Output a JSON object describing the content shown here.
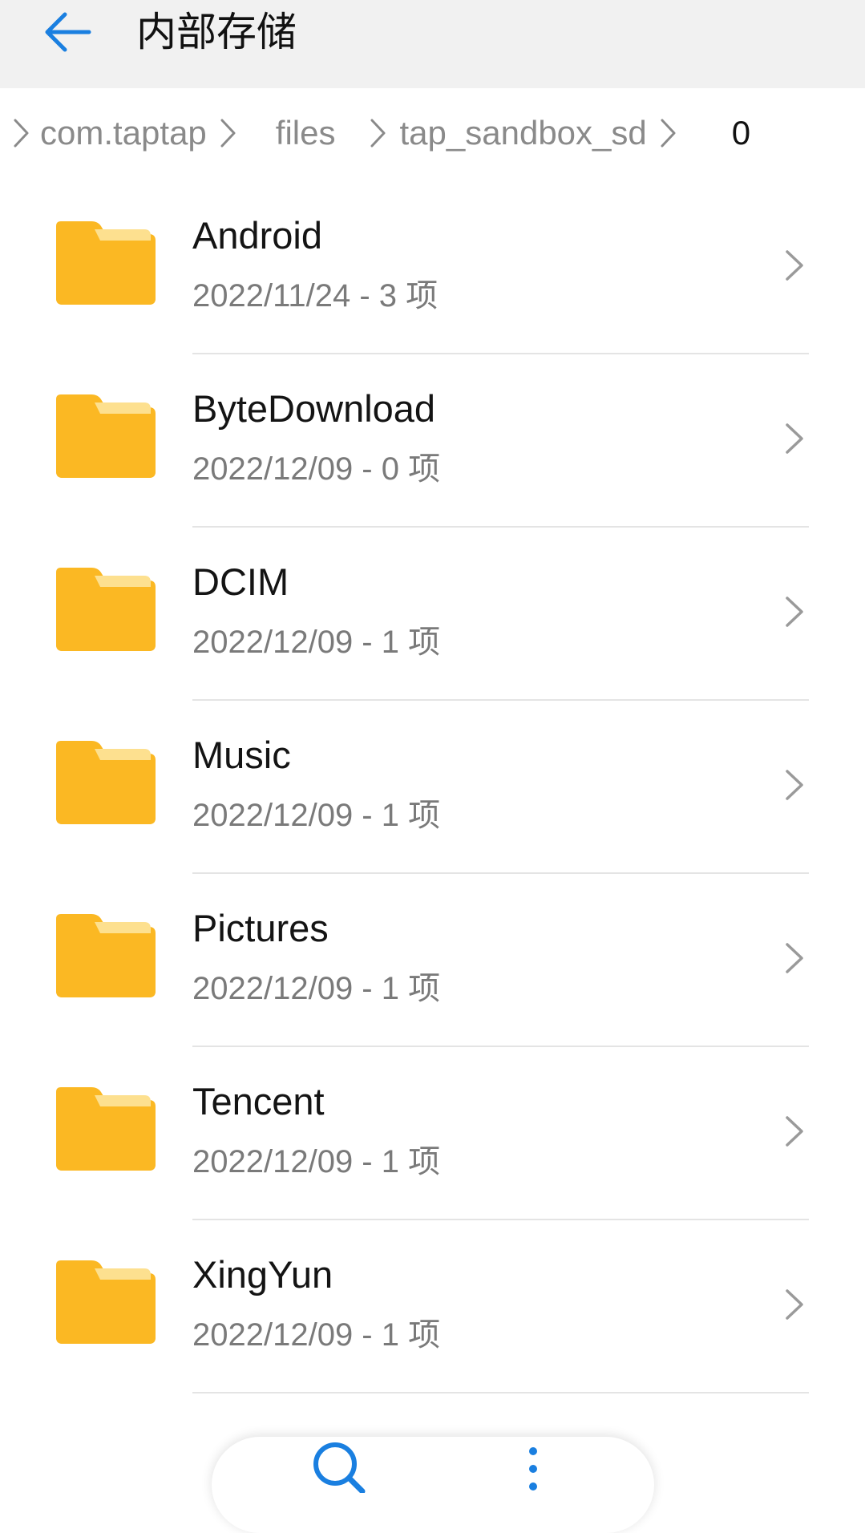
{
  "header": {
    "title": "内部存储",
    "back_icon": "arrow-left-icon",
    "accent_color": "#1a7fe0"
  },
  "breadcrumb": {
    "items": [
      "com.taptap",
      "files",
      "tap_sandbox_sd",
      "0"
    ],
    "separator_icon": "chevron-right-icon"
  },
  "folders": [
    {
      "name": "Android",
      "meta": "2022/11/24 - 3 项"
    },
    {
      "name": "ByteDownload",
      "meta": "2022/12/09 - 0 项"
    },
    {
      "name": "DCIM",
      "meta": "2022/12/09 - 1 项"
    },
    {
      "name": "Music",
      "meta": "2022/12/09 - 1 项"
    },
    {
      "name": "Pictures",
      "meta": "2022/12/09 - 1 项"
    },
    {
      "name": "Tencent",
      "meta": "2022/12/09 - 1 项"
    },
    {
      "name": "XingYun",
      "meta": "2022/12/09 - 1 项"
    }
  ],
  "folder_color": "#fbb823",
  "folder_tab_color": "#fde08f",
  "bottom_bar": {
    "search_icon": "search-icon",
    "more_icon": "more-vertical-icon"
  }
}
